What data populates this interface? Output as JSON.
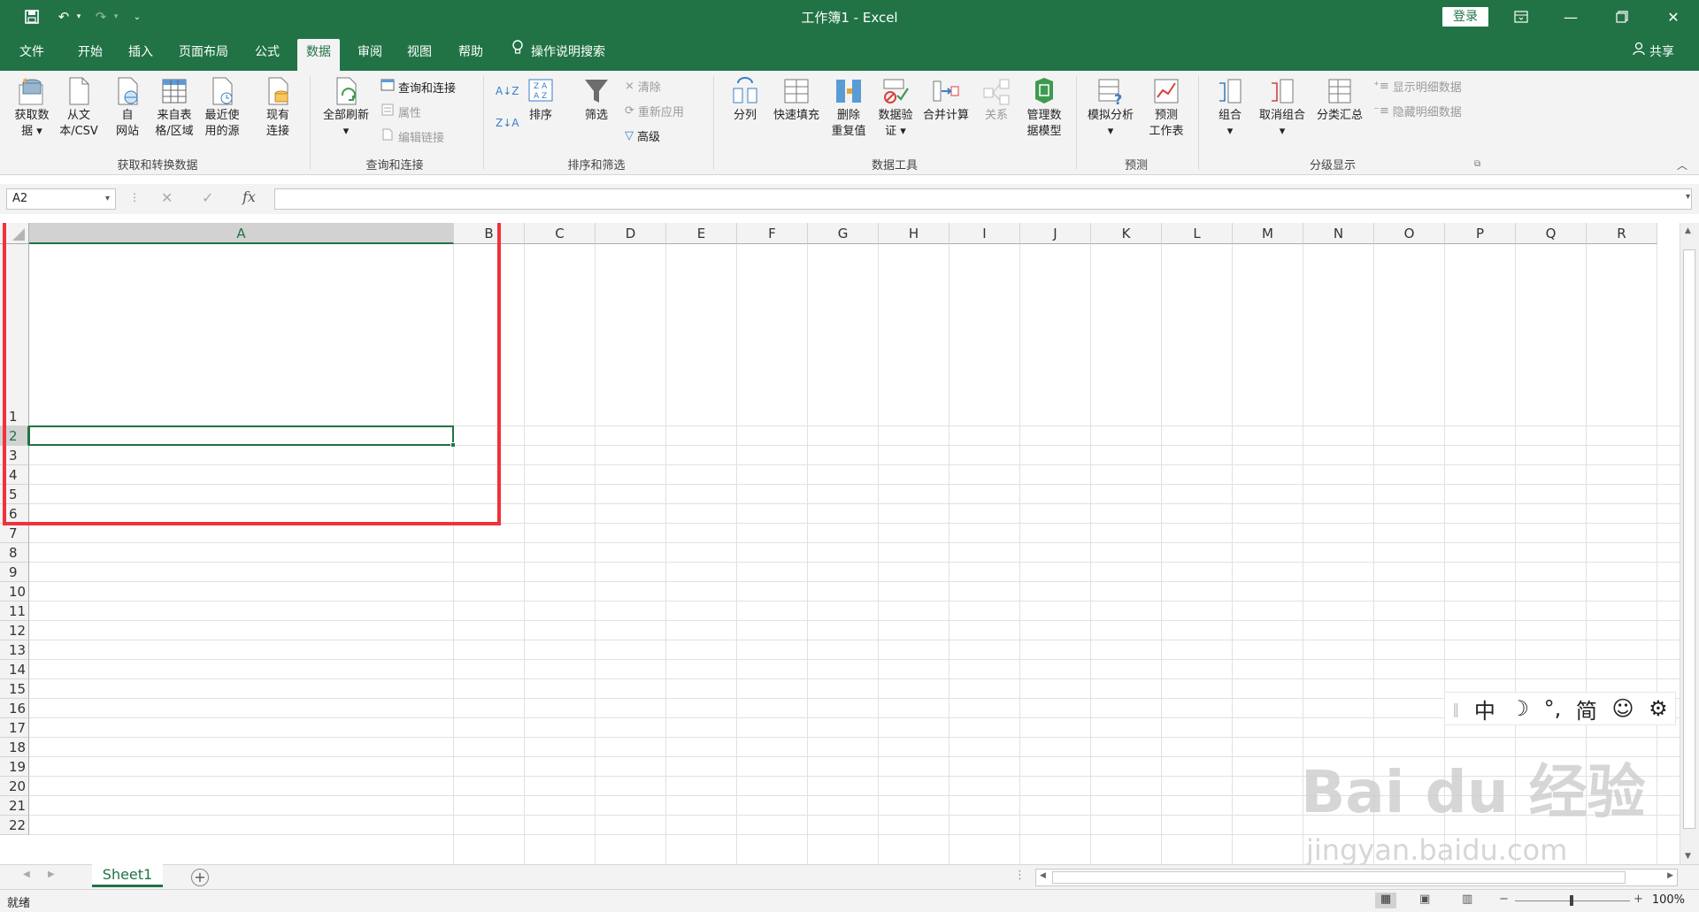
{
  "titlebar": {
    "title": "工作簿1  -  Excel",
    "login_label": "登录"
  },
  "tabs": [
    {
      "label": "文件"
    },
    {
      "label": "开始"
    },
    {
      "label": "插入"
    },
    {
      "label": "页面布局"
    },
    {
      "label": "公式"
    },
    {
      "label": "数据"
    },
    {
      "label": "审阅"
    },
    {
      "label": "视图"
    },
    {
      "label": "帮助"
    }
  ],
  "tell_me": "操作说明搜索",
  "share": "共享",
  "ribbon": {
    "get_data": "获取数\n据 ▾",
    "from_text": "从文\n本/CSV",
    "from_web": "自\n网站",
    "from_table": "来自表\n格/区域",
    "recent_sources": "最近使\n用的源",
    "existing_conn": "现有\n连接",
    "group_get": "获取和转换数据",
    "refresh_all": "全部刷新\n▾",
    "queries_conn": "查询和连接",
    "properties": "属性",
    "edit_links": "编辑链接",
    "group_queries": "查询和连接",
    "sort": "排序",
    "filter": "筛选",
    "clear": "清除",
    "reapply": "重新应用",
    "advanced": "高级",
    "group_sort": "排序和筛选",
    "text_to_cols": "分列",
    "flash_fill": "快速填充",
    "remove_dup": "删除\n重复值",
    "data_valid": "数据验\n证 ▾",
    "consolidate": "合并计算",
    "relations": "关系",
    "data_model": "管理数\n据模型",
    "group_tools": "数据工具",
    "what_if": "模拟分析\n▾",
    "forecast_sheet": "预测\n工作表",
    "group_forecast": "预测",
    "group_btn": "组合\n▾",
    "ungroup": "取消组合\n▾",
    "subtotal": "分类汇总",
    "show_detail": "显示明细数据",
    "hide_detail": "隐藏明细数据",
    "group_outline": "分级显示"
  },
  "formula_bar": {
    "name_box": "A2",
    "fx": "fx"
  },
  "columns": [
    "A",
    "B",
    "C",
    "D",
    "E",
    "F",
    "G",
    "H",
    "I",
    "J",
    "K",
    "L",
    "M",
    "N",
    "O",
    "P",
    "Q",
    "R"
  ],
  "rows": [
    "1",
    "2",
    "3",
    "4",
    "5",
    "6",
    "7",
    "8",
    "9",
    "10",
    "11",
    "12",
    "13",
    "14",
    "15",
    "16",
    "17",
    "18",
    "19",
    "20",
    "21",
    "22"
  ],
  "ime": [
    "中",
    "☽",
    "°,",
    "简",
    "☺",
    "⚙"
  ],
  "watermark": "Bai du 经验",
  "watermark_url": "jingyan.baidu.com",
  "sheet_tab": "Sheet1",
  "status": {
    "ready": "就绪",
    "zoom": "100%"
  },
  "colors": {
    "excel_green": "#217346",
    "highlight_red": "#f0323c"
  }
}
